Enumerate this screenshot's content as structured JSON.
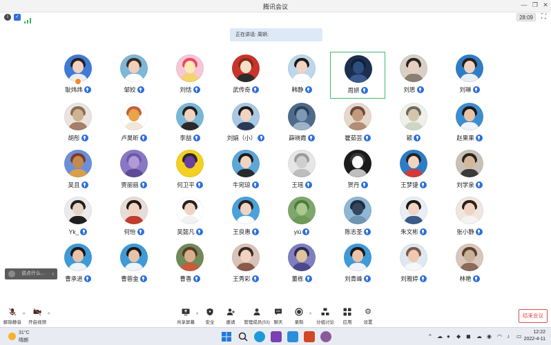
{
  "window": {
    "title": "腾讯会议"
  },
  "status": {
    "timer": "28:09"
  },
  "speaking": {
    "text": "正在讲话: 周妍;"
  },
  "participants": [
    {
      "name": "耿炜炜",
      "bg": "#3e7bd6",
      "skin": "#f1d3bf",
      "hair": "#2a2020",
      "body": "#e9edf3",
      "host": true
    },
    {
      "name": "邹姣",
      "bg": "#7fb7d8",
      "skin": "#f0d0bb",
      "hair": "#3a2a22",
      "body": "#ffffff"
    },
    {
      "name": "刘恬",
      "bg": "#f6c7d6",
      "skin": "#ffe9b3",
      "hair": "#e8476a",
      "body": "#f6d36b"
    },
    {
      "name": "武传奇",
      "bg": "#c8342b",
      "skin": "#f2e0c4",
      "hair": "#8a2a1d",
      "body": "#2c2c2c"
    },
    {
      "name": "韩静",
      "bg": "#bcd7ea",
      "skin": "#f0d3c2",
      "hair": "#1f1a18",
      "body": "#ffffff"
    },
    {
      "name": "周妍",
      "bg": "#1d2f4f",
      "skin": "#2e4e7e",
      "hair": "#12203a",
      "body": "#3b5b8e",
      "active": true
    },
    {
      "name": "刘思",
      "bg": "#d8d0c4",
      "skin": "#e7d0bf",
      "hair": "#2b2523",
      "body": "#8b7e72"
    },
    {
      "name": "刘琳",
      "bg": "#2f7ec5",
      "skin": "#f1d3c2",
      "hair": "#2a1f1c",
      "body": "#e9eef5"
    },
    {
      "name": "胡彤",
      "bg": "#e9e4de",
      "skin": "#cfb28f",
      "hair": "#8a6b56",
      "body": "#a57f68"
    },
    {
      "name": "卢昊昕",
      "bg": "#ffffff",
      "skin": "#e9a34b",
      "hair": "#c0603a",
      "body": "#f2e6d8"
    },
    {
      "name": "李喆",
      "bg": "#79b7d6",
      "skin": "#f1d3c2",
      "hair": "#24201d",
      "body": "#2a2a2a"
    },
    {
      "name": "刘娟（小）",
      "bg": "#a8c8e4",
      "skin": "#f0d3c2",
      "hair": "#1f1a18",
      "body": "#2b3a55"
    },
    {
      "name": "薛晓霞",
      "bg": "#4e6b8c",
      "skin": "#7e99b6",
      "hair": "#2c4059",
      "body": "#9fb3c8"
    },
    {
      "name": "瞿茹芸",
      "bg": "#e7d8cc",
      "skin": "#c39a7e",
      "hair": "#6b4a3a",
      "body": "#b28e76"
    },
    {
      "name": "颖",
      "bg": "#eef0ea",
      "skin": "#d4c6ad",
      "hair": "#6e6a5a",
      "body": "#cfd6c4"
    },
    {
      "name": "赵果果",
      "bg": "#3b8fd0",
      "skin": "#e8c3a8",
      "hair": "#1d1816",
      "body": "#f0f3f7"
    },
    {
      "name": "吴且",
      "bg": "#6b8fd9",
      "skin": "#c28a4f",
      "hair": "#7d3a2a",
      "body": "#d8a04a"
    },
    {
      "name": "贾丽丽",
      "bg": "#8a78c4",
      "skin": "#b19ad6",
      "hair": "#6a58a8",
      "body": "#5e4a98"
    },
    {
      "name": "何卫平",
      "bg": "#f3d021",
      "skin": "#6a3fa0",
      "hair": "#2b2b2b",
      "body": "#f3d021"
    },
    {
      "name": "牛宛琼",
      "bg": "#5aa7d8",
      "skin": "#f1d3c2",
      "hair": "#1f1a18",
      "body": "#2a2a2a"
    },
    {
      "name": "王瑶",
      "bg": "#e6e6e6",
      "skin": "#cfcfcf",
      "hair": "#9a9a9a",
      "body": "#bdbdbd"
    },
    {
      "name": "贺丹",
      "bg": "#1c1c1c",
      "skin": "#ffffff",
      "hair": "#3a3a3a",
      "body": "#bfbfbf"
    },
    {
      "name": "王梦捷",
      "bg": "#2b7ec6",
      "skin": "#f1d3c2",
      "hair": "#2a1f1c",
      "body": "#d33b3b"
    },
    {
      "name": "刘学泉",
      "bg": "#c9c1b5",
      "skin": "#d7b79b",
      "hair": "#2a2421",
      "body": "#3a3a3a"
    },
    {
      "name": "Yk_",
      "bg": "#ebebeb",
      "skin": "#e6d3c3",
      "hair": "#202020",
      "body": "#1f1f1f"
    },
    {
      "name": "何怡",
      "bg": "#e7dcd6",
      "skin": "#f1d3c2",
      "hair": "#1f1a18",
      "body": "#c23b2f"
    },
    {
      "name": "吴懿凡",
      "bg": "#ffffff",
      "skin": "#f1d3c2",
      "hair": "#2a1f1c",
      "body": "#f2f2f2"
    },
    {
      "name": "王良惠",
      "bg": "#4aa1db",
      "skin": "#f1d3c2",
      "hair": "#2a1f1c",
      "body": "#ffffff"
    },
    {
      "name": "yiū",
      "bg": "#7fa76b",
      "skin": "#a9c98e",
      "hair": "#4e7a3e",
      "body": "#6f9a59"
    },
    {
      "name": "陈志圣",
      "bg": "#8fb6d4",
      "skin": "#33475f",
      "hair": "#1f2d3f",
      "body": "#6f94b4"
    },
    {
      "name": "朱文彬",
      "bg": "#e9eef4",
      "skin": "#f0d3c2",
      "hair": "#1d1816",
      "body": "#3b5a8a"
    },
    {
      "name": "张小静",
      "bg": "#f0e6de",
      "skin": "#f1d3c2",
      "hair": "#2a1f1c",
      "body": "#f4f4f4"
    },
    {
      "name": "曹承进",
      "bg": "#3f9ad8",
      "skin": "#e8c3a8",
      "hair": "#1d1816",
      "body": "#f0f3f7"
    },
    {
      "name": "曹蓉金",
      "bg": "#3f9ad8",
      "skin": "#e8c3a8",
      "hair": "#1d1816",
      "body": "#f0f3f7"
    },
    {
      "name": "曹香",
      "bg": "#6f8a57",
      "skin": "#d9b08c",
      "hair": "#5a3a2a",
      "body": "#c95a3b"
    },
    {
      "name": "王秀彩",
      "bg": "#d9c2b8",
      "skin": "#f1d3c2",
      "hair": "#3a2a22",
      "body": "#8a5a4a"
    },
    {
      "name": "董栋",
      "bg": "#7f7fbf",
      "skin": "#e0c39a",
      "hair": "#2b2b55",
      "body": "#4a4a8a"
    },
    {
      "name": "刘青峰",
      "bg": "#3f9ad8",
      "skin": "#e8c3a8",
      "hair": "#1d1816",
      "body": "#f0f3f7"
    },
    {
      "name": "刘雅婷",
      "bg": "#dfe8f2",
      "skin": "#f2c7b0",
      "hair": "#7a5a4a",
      "body": "#f7f7f7"
    },
    {
      "name": "林艳",
      "bg": "#d8c7ba",
      "skin": "#c8b09a",
      "hair": "#5a3f2f",
      "body": "#8a6a5a"
    }
  ],
  "chat": {
    "placeholder": "说点什么..."
  },
  "toolbar": {
    "mute": "解除静音",
    "video": "开启视频",
    "share": "共享屏幕",
    "security": "安全",
    "invite": "邀请",
    "members": "管理成员(53)",
    "chat": "聊天",
    "record": "录制",
    "breakout": "分组讨论",
    "apps": "应用",
    "settings": "设置",
    "end": "结束会议"
  },
  "taskbar": {
    "weather_temp": "31°C",
    "weather_desc": "晴朗",
    "time": "12:22",
    "date": "2022-4-11"
  }
}
